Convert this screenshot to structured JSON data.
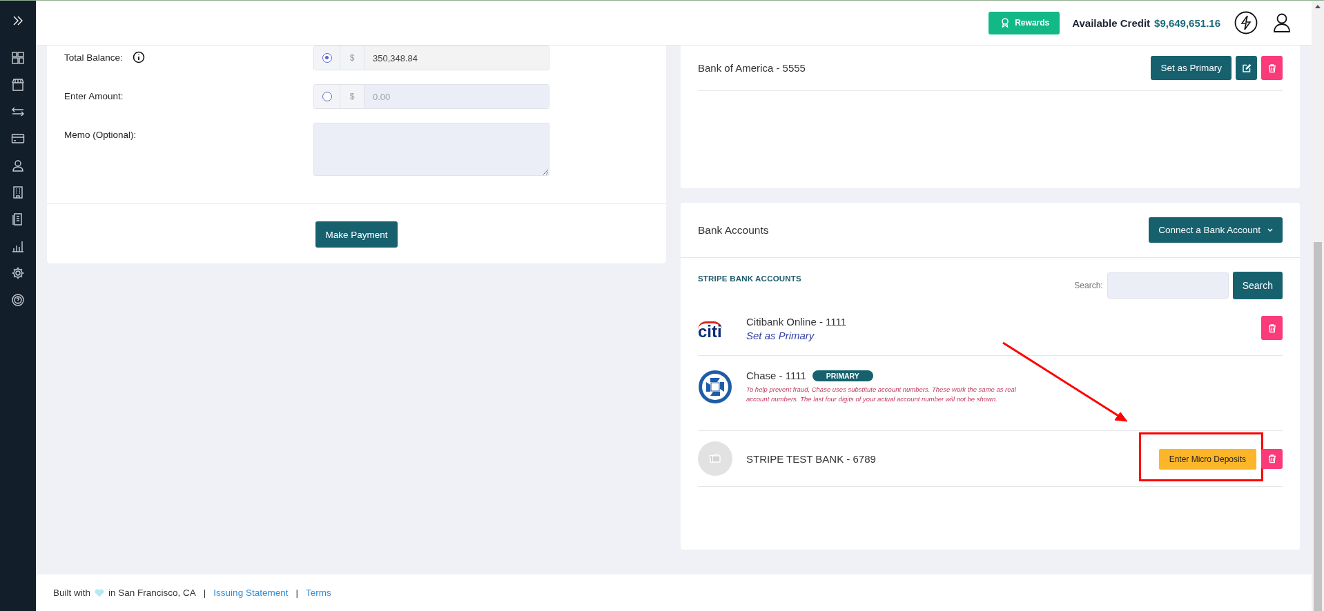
{
  "header": {
    "rewards_button": "Rewards",
    "credit_label": "Available Credit",
    "credit_value": "$9,649,651.16"
  },
  "payment_form": {
    "fields": [
      {
        "kind": "amount",
        "label": "Total Balance:",
        "info": true,
        "selected": true,
        "currency": "$",
        "value": "350,348.84"
      },
      {
        "kind": "amount",
        "label": "Enter Amount:",
        "info": false,
        "selected": false,
        "currency": "$",
        "placeholder": "0.00"
      },
      {
        "kind": "memo",
        "label": "Memo (Optional):"
      }
    ],
    "submit_button": "Make Payment"
  },
  "primary_account": {
    "name": "Bank of America - 5555",
    "set_primary_button": "Set as Primary"
  },
  "bank_accounts": {
    "title": "Bank Accounts",
    "connect_button": "Connect a Bank Account",
    "section_title": "STRIPE BANK ACCOUNTS",
    "search_label": "Search:",
    "search_button": "Search",
    "accounts": [
      {
        "name": "Citibank Online - 1111",
        "kind": "citi",
        "logo_text": "citi",
        "link": "Set as Primary",
        "highlighted": false
      },
      {
        "name": "Chase - 1111",
        "kind": "chase",
        "badge": "PRIMARY",
        "note": "To help prevent fraud, Chase uses substitute account numbers. These work the same as real account numbers. The last four digits of your actual account number will not be shown.",
        "highlighted": false
      },
      {
        "name": "STRIPE TEST BANK - 6789",
        "kind": "none",
        "action": "Enter Micro Deposits",
        "highlighted": true
      }
    ]
  },
  "footer": {
    "before_heart": "Built with",
    "after_heart": "in San Francisco, CA",
    "links": [
      {
        "separator": "|",
        "label": "Issuing Statement"
      },
      {
        "separator": "|",
        "label": "Terms"
      }
    ]
  }
}
